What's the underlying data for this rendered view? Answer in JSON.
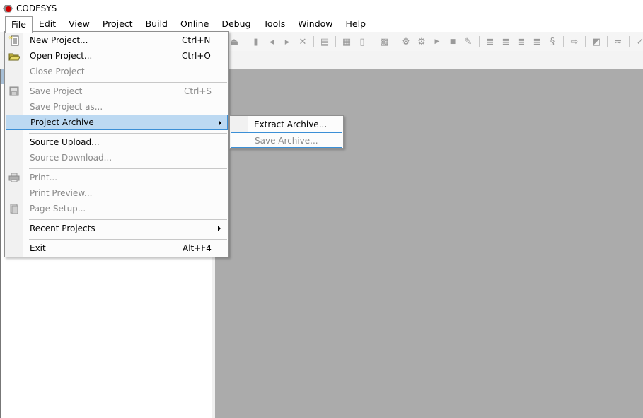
{
  "app": {
    "title": "CODESYS",
    "logo": "codesys-logo-icon"
  },
  "menubar": {
    "items": [
      {
        "label": "File",
        "active": true
      },
      {
        "label": "Edit"
      },
      {
        "label": "View"
      },
      {
        "label": "Project"
      },
      {
        "label": "Build"
      },
      {
        "label": "Online"
      },
      {
        "label": "Debug"
      },
      {
        "label": "Tools"
      },
      {
        "label": "Window"
      },
      {
        "label": "Help"
      }
    ]
  },
  "file_menu": {
    "items": [
      {
        "label": "New Project...",
        "shortcut": "Ctrl+N",
        "icon": "new-project-icon",
        "enabled": true
      },
      {
        "label": "Open Project...",
        "shortcut": "Ctrl+O",
        "icon": "open-folder-icon",
        "enabled": true
      },
      {
        "label": "Close Project",
        "shortcut": "",
        "enabled": false
      },
      {
        "label": "Save Project",
        "shortcut": "Ctrl+S",
        "icon": "save-icon",
        "enabled": false
      },
      {
        "label": "Save Project as...",
        "shortcut": "",
        "enabled": false
      },
      {
        "label": "Project Archive",
        "shortcut": "",
        "submenu": true,
        "highlighted": true,
        "enabled": true
      },
      {
        "label": "Source Upload...",
        "shortcut": "",
        "enabled": true
      },
      {
        "label": "Source Download...",
        "shortcut": "",
        "enabled": false
      },
      {
        "label": "Print...",
        "shortcut": "",
        "icon": "print-icon",
        "enabled": false
      },
      {
        "label": "Print Preview...",
        "shortcut": "",
        "enabled": false
      },
      {
        "label": "Page Setup...",
        "shortcut": "",
        "icon": "page-setup-icon",
        "enabled": false
      },
      {
        "label": "Recent Projects",
        "shortcut": "",
        "submenu": true,
        "enabled": true
      },
      {
        "label": "Exit",
        "shortcut": "Alt+F4",
        "enabled": true
      }
    ]
  },
  "archive_submenu": {
    "items": [
      {
        "label": "Extract Archive...",
        "enabled": true
      },
      {
        "label": "Save Archive...",
        "enabled": false,
        "focused": true
      }
    ]
  },
  "toolbar": {
    "icons": [
      "upload-icon",
      "bookmark-icon",
      "prev-bookmark-icon",
      "next-bookmark-icon",
      "clear-bookmark-icon",
      "clipboard-icon",
      "insert-icon",
      "new-object-icon",
      "watch-icon",
      "login-icon",
      "logout-icon",
      "run-icon",
      "stop-icon",
      "tools-icon",
      "step-over-icon",
      "step-into-icon",
      "step-out-icon",
      "run-to-cursor-icon",
      "set-next-icon",
      "show-next-icon",
      "force-icon",
      "filter-icon",
      "check-icon"
    ]
  },
  "colors": {
    "highlight_bg": "#bcd9f2",
    "highlight_border": "#3b8fd6",
    "workspace_bg": "#ababab",
    "disabled_text": "#8a8a8a"
  }
}
